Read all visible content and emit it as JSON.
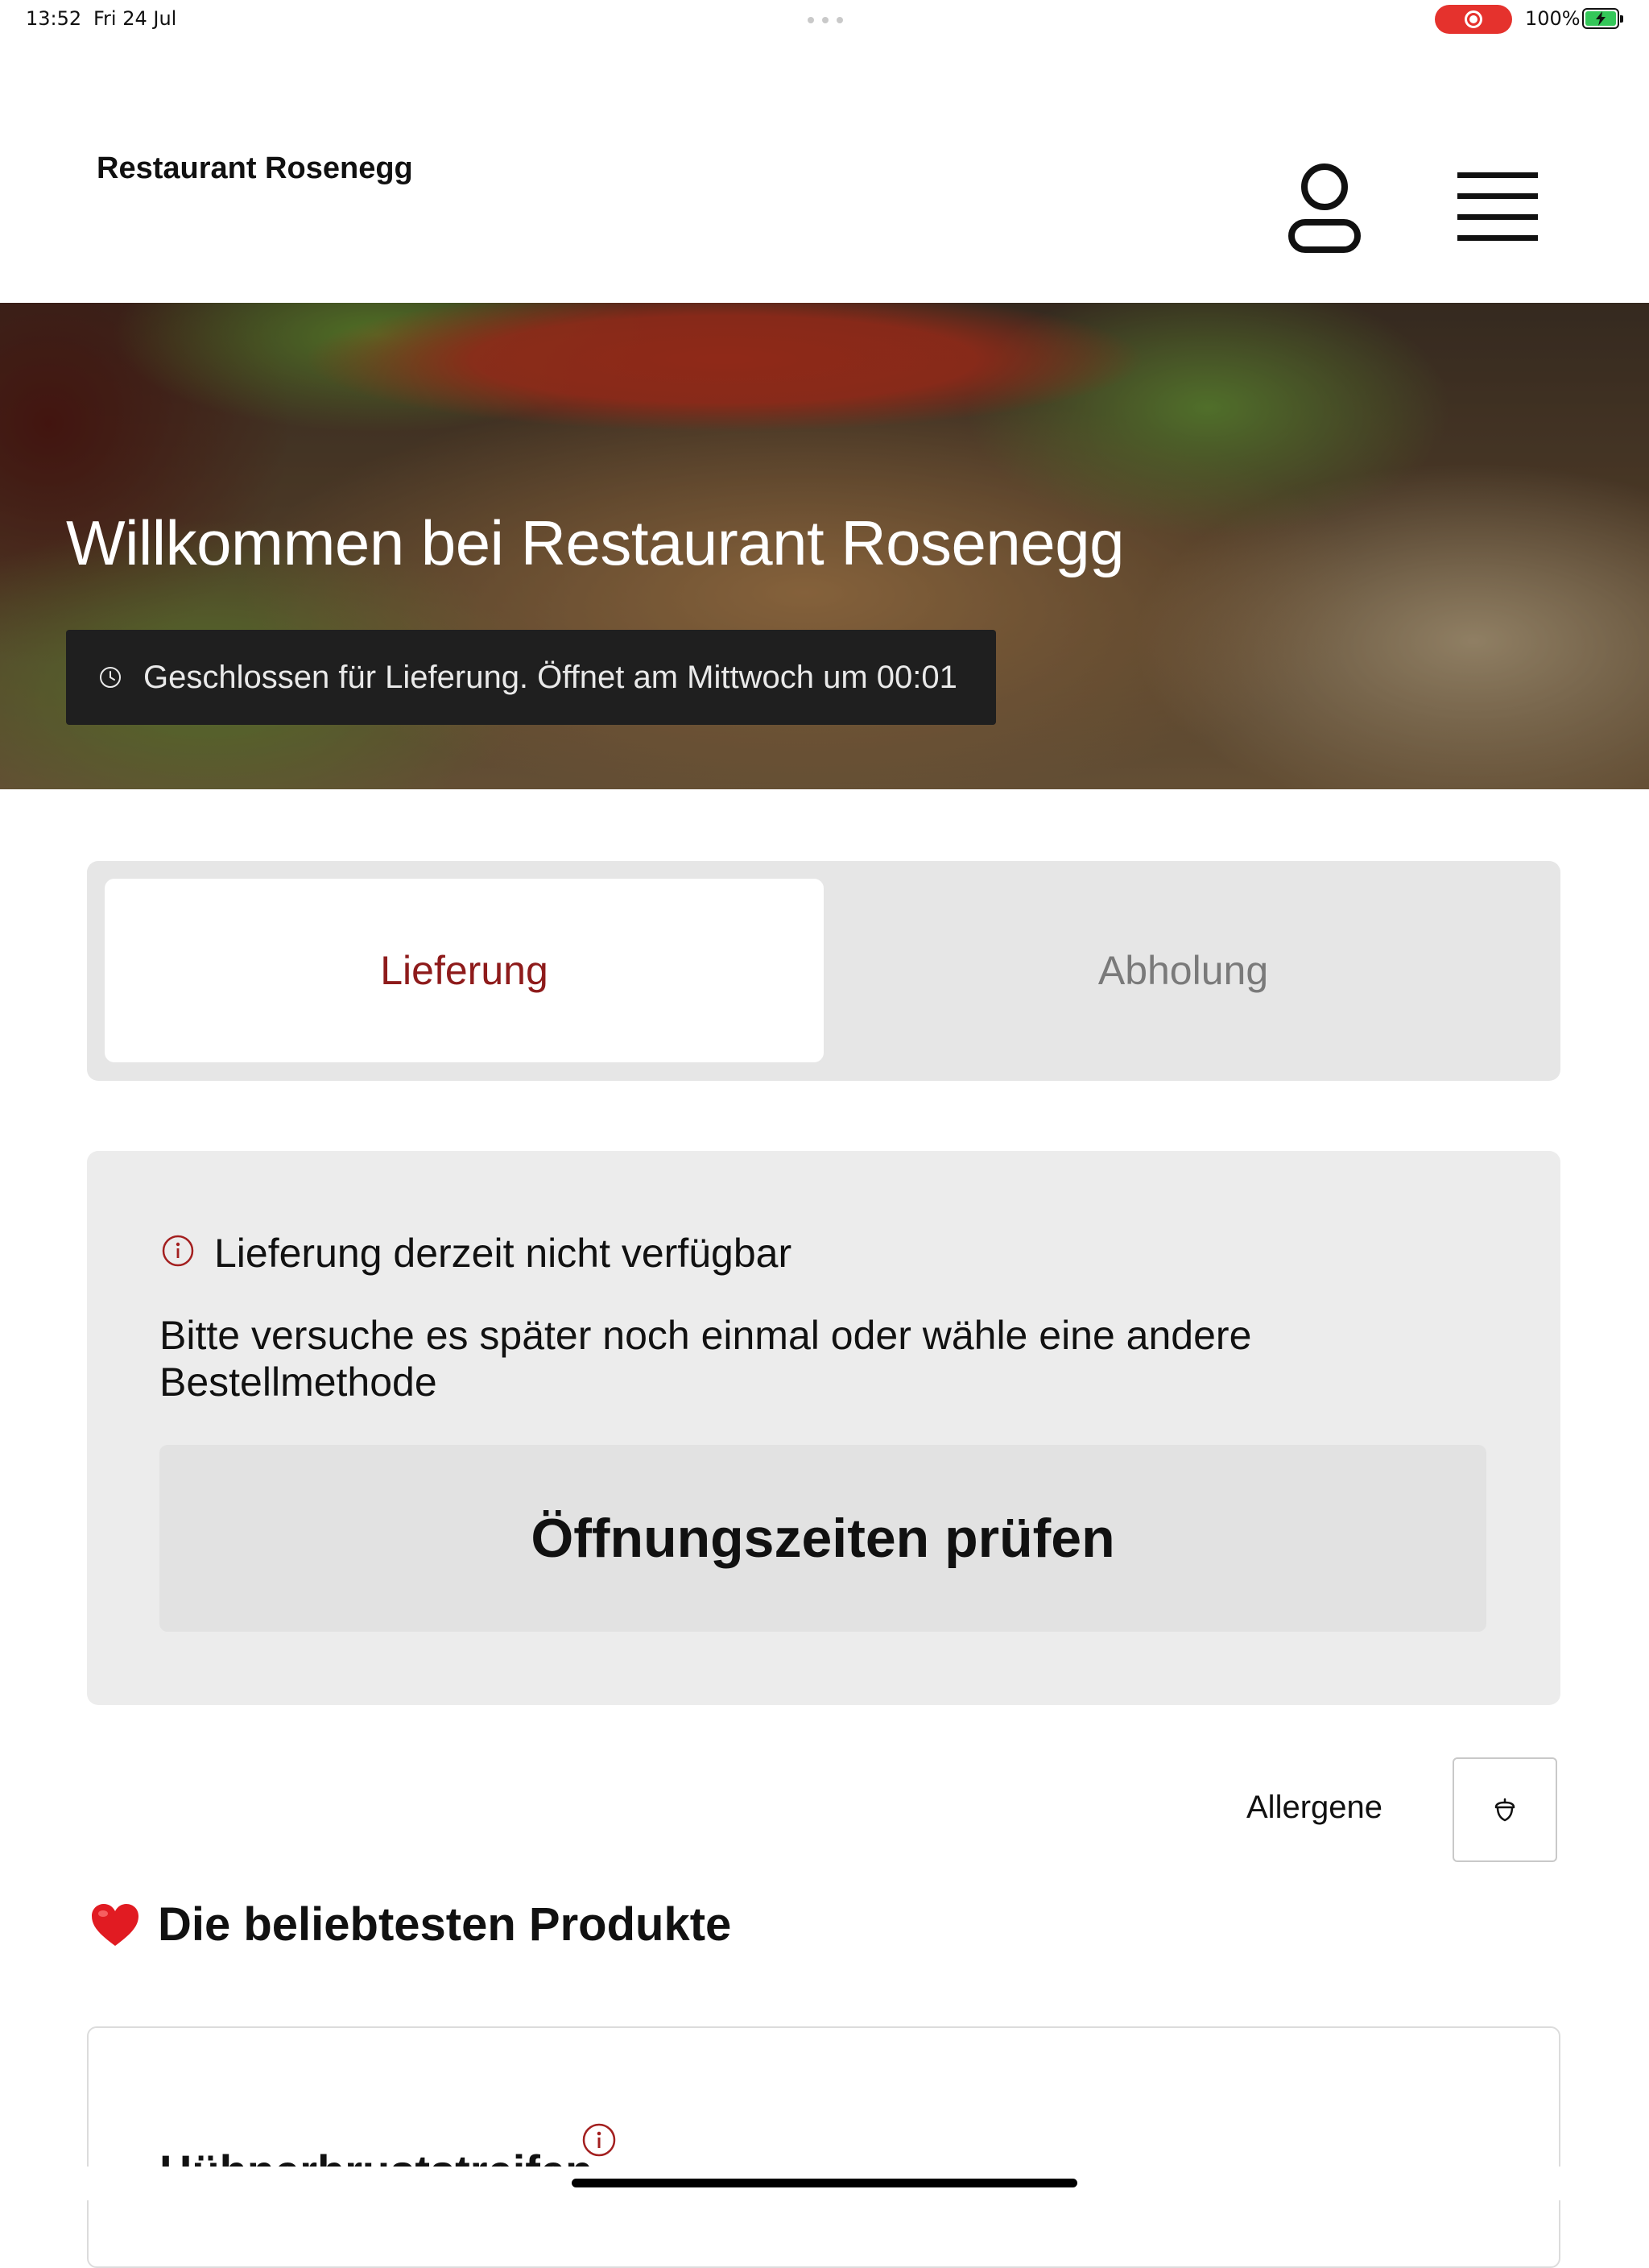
{
  "status_bar": {
    "time": "13:52",
    "date": "Fri 24 Jul",
    "battery": "100%",
    "record_color": "#e5322d"
  },
  "header": {
    "brand": "Restaurant Rosenegg",
    "user_icon": "user-icon",
    "menu_icon": "hamburger-menu-icon"
  },
  "hero": {
    "title": "Willkommen bei Restaurant Rosenegg",
    "status_icon": "clock-icon",
    "status_text": "Geschlossen für Lieferung. Öffnet am Mittwoch um 00:01"
  },
  "order_tabs": {
    "active": "Lieferung",
    "items": [
      {
        "label": "Lieferung",
        "selected": true
      },
      {
        "label": "Abholung",
        "selected": false
      }
    ],
    "accent": "#8e1b1b"
  },
  "notice": {
    "icon": "info-icon",
    "title": "Lieferung derzeit nicht verfügbar",
    "text": "Bitte versuche es später noch einmal oder wähle eine andere Bestellmethode",
    "button": "Öffnungszeiten prüfen"
  },
  "allergens": {
    "label": "Allergene",
    "icon": "acorn-icon"
  },
  "popular": {
    "icon": "heart-icon",
    "title": "Die beliebtesten Produkte",
    "products": [
      {
        "name": "Hühnerbruststreifen",
        "info_icon": "info-icon"
      }
    ]
  }
}
